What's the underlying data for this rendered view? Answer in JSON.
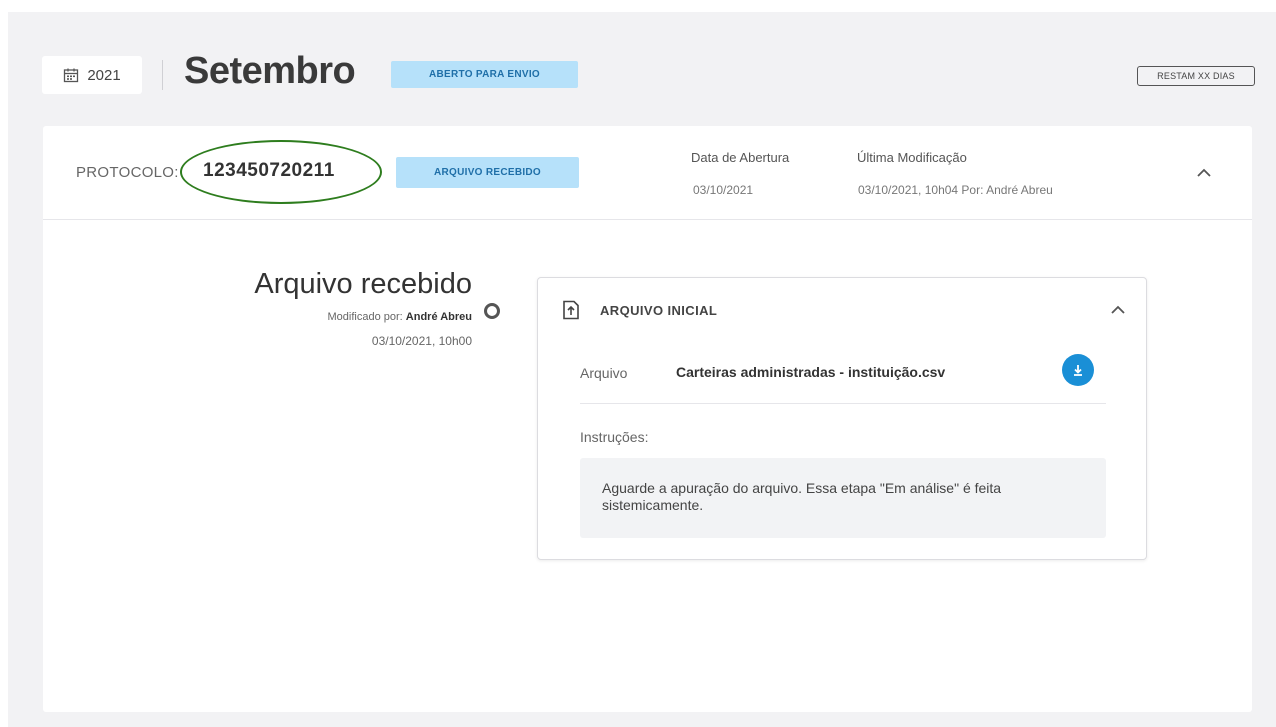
{
  "header": {
    "year": "2021",
    "month": "Setembro",
    "status_badge": "ABERTO PARA ENVIO",
    "remaining_badge": "RESTAM XX DIAS"
  },
  "protocol": {
    "label": "PROTOCOLO:",
    "number": "123450720211",
    "status": "ARQUIVO RECEBIDO",
    "opened_label": "Data de Abertura",
    "opened_date": "03/10/2021",
    "modified_label": "Última Modificação",
    "modified_value": "03/10/2021, 10h04 Por: André Abreu"
  },
  "timeline": {
    "title": "Arquivo recebido",
    "modified_prefix": "Modificado por:",
    "modified_by": "André Abreu",
    "date": "03/10/2021, 10h00"
  },
  "file_card": {
    "title": "ARQUIVO INICIAL",
    "file_label": "Arquivo",
    "file_name": "Carteiras administradas -  instituição.csv",
    "instructions_label": "Instruções:",
    "instructions_text": "Aguarde a apuração do arquivo. Essa etapa \"Em análise\" é feita sistemicamente."
  },
  "colors": {
    "badge_bg": "#b6e1fa",
    "badge_text": "#1f6fa8",
    "download_button": "#1a8fd6",
    "highlight_ring": "#2e7d1e"
  }
}
